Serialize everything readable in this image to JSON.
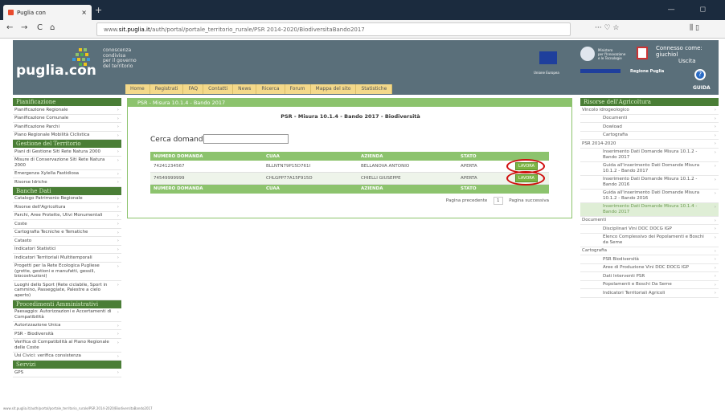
{
  "browser": {
    "tab_title": "Puglia con",
    "tab_close": "×",
    "new_tab": "+",
    "url_prefix": "www.",
    "url_domain": "sit.puglia.it",
    "url_path": "/auth/portal/portale_territorio_rurale/PSR 2014-2020/BiodiversitaBando2017",
    "nav_back": "←",
    "nav_forward": "→",
    "nav_reload": "C",
    "nav_home": "⌂",
    "toolbar_right": "··· ♡ ☆",
    "win_controls": "— ◻"
  },
  "header": {
    "logo": "puglia.con",
    "tagline": [
      "conoscenza",
      "condivisa",
      "per il governo",
      "del territorio"
    ],
    "eu_label": "Unione Europea",
    "ministry": [
      "Ministero",
      "per l'Innovazione",
      "e le Tecnologie"
    ],
    "region": "Regione Puglia",
    "connected": "Connesso come: giuchiol",
    "logout": "Uscita",
    "help": "GUIDA",
    "help_glyph": "?"
  },
  "topnav": [
    "Home",
    "Registrati",
    "FAQ",
    "Contatti",
    "News",
    "Ricerca",
    "Forum",
    "Mappa del sito",
    "Statistiche"
  ],
  "left": [
    {
      "title": "Pianificazione",
      "items": [
        "Pianificazione Regionale",
        "Pianificazione Comunale",
        "Pianificazione Parchi",
        "Piano Regionale Mobilità Ciclistica"
      ]
    },
    {
      "title": "Gestione del Territorio",
      "items": [
        "Piani di Gestione Siti Rete Natura 2000",
        "Misure di Conservazione Siti Rete Natura 2000",
        "Emergenza Xylella Fastidiosa",
        "Risorse Idriche"
      ]
    },
    {
      "title": "Banche Dati",
      "items": [
        "Catalogo Patrimonio Regionale",
        "Risorse dell'Agricoltura",
        "Parchi, Aree Protette, Ulivi Monumentali",
        "Coste",
        "Cartografia Tecniche e Tematiche",
        "Catasto",
        "Indicatori Statistici",
        "Indicatori Territoriali Multitemporali",
        "Progetti per la Rete Ecologica Pugliese (grotte, gestioni e manufatti, gessili, biocostruzioni)",
        "Luoghi dello Sport (Rete ciclabile, Sport in cammino, Passeggiate, Palestre a cielo aperto)"
      ]
    },
    {
      "title": "Procedimenti Amministrativi",
      "items": [
        "Paesaggio: Autorizzazioni e Accertamenti di Compatibilità",
        "Autorizzazione Unica",
        "PSR - Biodiversità",
        "Verifica di Compatibilità al Piano Regionale delle Coste",
        "Usi Civici: verifica consistenza"
      ]
    },
    {
      "title": "Servizi",
      "items": [
        "GPS"
      ]
    }
  ],
  "center": {
    "panel_title": "PSR - Misura 10.1.4 - Bando 2017",
    "subtitle": "PSR - Misura 10.1.4 - Bando 2017 - Biodiversità",
    "search_label": "Cerca domanda",
    "search_value": "",
    "columns": [
      "NUMERO DOMANDA",
      "CUAA",
      "AZIENDA",
      "STATO",
      ""
    ],
    "sort_glyph": "↕",
    "rows": [
      {
        "numero": "74241234567",
        "cuaa": "BLLNTN79P15D761I",
        "azienda": "BELLANOVA ANTONIO",
        "stato": "APERTA",
        "action": "LAVORA"
      },
      {
        "numero": "74549999999",
        "cuaa": "CHLGPP77A15F915D",
        "azienda": "CHIELLI GIUSEPPE",
        "stato": "APERTA",
        "action": "LAVORA"
      }
    ],
    "pager": {
      "prev": "Pagina precedente",
      "page": "1",
      "next": "Pagina successiva"
    }
  },
  "right": [
    {
      "title": "Risorse dell'Agricoltura",
      "kind": "head"
    },
    {
      "label": "Vincolo idrogeologico",
      "kind": "group"
    },
    {
      "label": "Documenti",
      "kind": "sub"
    },
    {
      "label": "Dowload",
      "kind": "sub"
    },
    {
      "label": "Cartografia",
      "kind": "sub"
    },
    {
      "label": "PSR 2014-2020",
      "kind": "group"
    },
    {
      "label": "Inserimento Dati Domande Misura 10.1.2 - Bando 2017",
      "kind": "sub"
    },
    {
      "label": "Guida all'inserimento Dati Domande Misura 10.1.2 - Bando 2017",
      "kind": "sub"
    },
    {
      "label": "Inserimento Dati Domande Misura 10.1.2 - Bando 2016",
      "kind": "sub"
    },
    {
      "label": "Guida all'inserimento Dati Domande Misura 10.1.2 - Bando 2016",
      "kind": "sub"
    },
    {
      "label": "Inserimento Dati Domande Misura 10.1.4 - Bando 2017",
      "kind": "sub-hl"
    },
    {
      "label": "Documenti",
      "kind": "group"
    },
    {
      "label": "Disciplinari Vini DOC DOCG IGP",
      "kind": "sub"
    },
    {
      "label": "Elenco Complessivo dei Popolamenti e Boschi da Seme",
      "kind": "sub"
    },
    {
      "label": "Cartografia",
      "kind": "group"
    },
    {
      "label": "PSR Biodiversità",
      "kind": "sub"
    },
    {
      "label": "Aree di Produzione Vini DOC DOCG IGP",
      "kind": "sub"
    },
    {
      "label": "Dati Interventi PSR",
      "kind": "sub"
    },
    {
      "label": "Popolamenti e Boschi Da Seme",
      "kind": "sub"
    },
    {
      "label": "Indicatori Territoriali Agricoli",
      "kind": "sub"
    }
  ],
  "statusbar": "www.sit.puglia.it/auth/portal/portale_territorio_rurale/PSR 2014-2020/BiodiversitaBando2017",
  "arrow_glyph": "›",
  "colors": {
    "green_head": "#4a7e36",
    "panel_green": "#8cc36d",
    "header_bg": "#5a6f7a",
    "highlight_red": "#d01010"
  }
}
